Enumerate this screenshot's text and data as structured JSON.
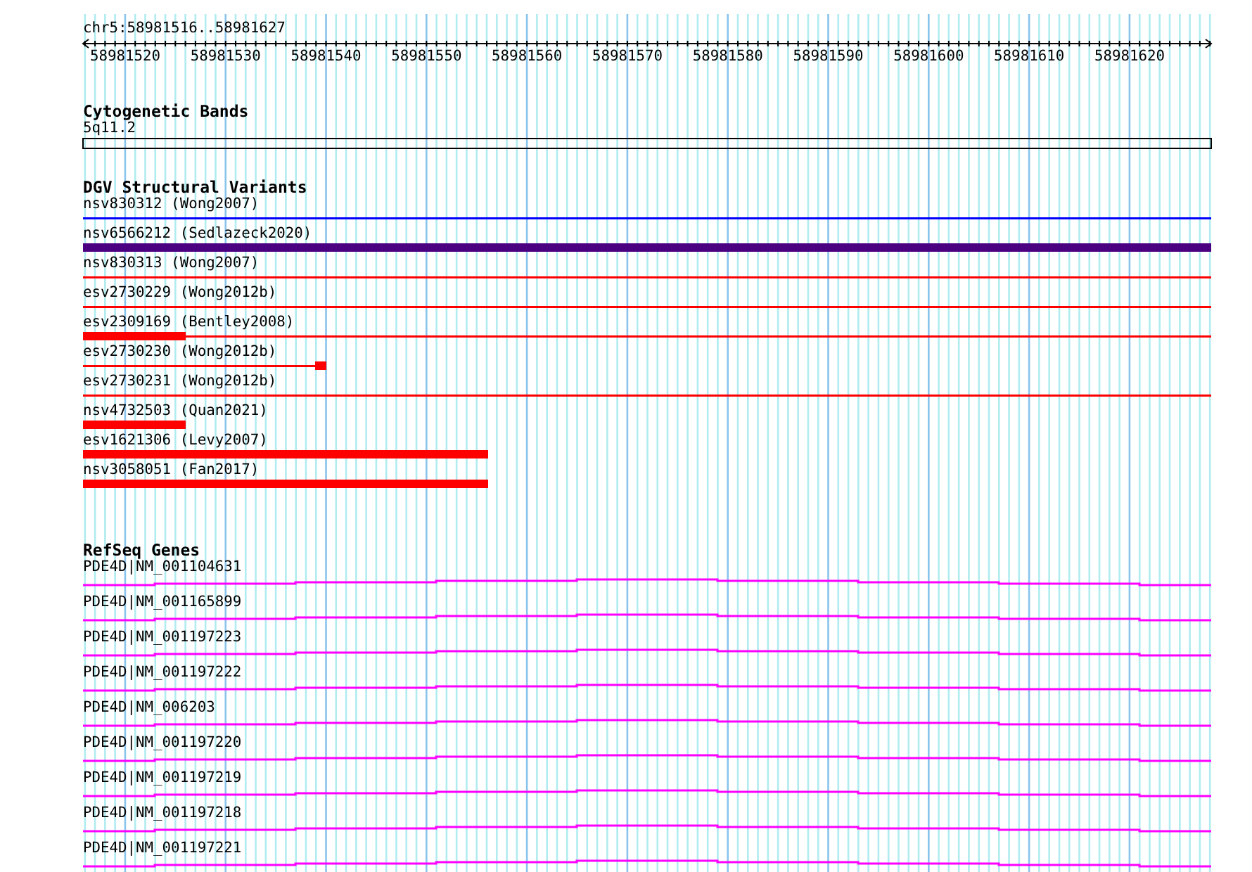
{
  "ruler": {
    "title": "chr5:58981516..58981627",
    "ticks": [
      "58981520",
      "58981530",
      "58981540",
      "58981550",
      "58981560",
      "58981570",
      "58981580",
      "58981590",
      "58981600",
      "58981610",
      "58981620"
    ]
  },
  "tracks": [
    {
      "title": "Cytogenetic Bands",
      "kind": "bands",
      "features": [
        {
          "label": "5q11.2"
        }
      ]
    },
    {
      "title": "DGV Structural Variants",
      "kind": "variants",
      "features": [
        {
          "label": "nsv830312 (Wong2007)",
          "color": "#0000ff"
        },
        {
          "label": "nsv6566212 (Sedlazeck2020)",
          "color": "#4b0082"
        },
        {
          "label": "nsv830313 (Wong2007)",
          "color": "#ff0000"
        },
        {
          "label": "esv2730229 (Wong2012b)",
          "color": "#ff0000"
        },
        {
          "label": "esv2309169 (Bentley2008)",
          "color": "#ff0000"
        },
        {
          "label": "esv2730230 (Wong2012b)",
          "color": "#ff0000"
        },
        {
          "label": "esv2730231 (Wong2012b)",
          "color": "#ff0000"
        },
        {
          "label": "nsv4732503 (Quan2021)",
          "color": "#ff0000"
        },
        {
          "label": "esv1621306 (Levy2007)",
          "color": "#ff0000"
        },
        {
          "label": "nsv3058051 (Fan2017)",
          "color": "#ff0000"
        }
      ]
    },
    {
      "title": "RefSeq Genes",
      "kind": "genes",
      "features": [
        {
          "label": "PDE4D|NM_001104631"
        },
        {
          "label": "PDE4D|NM_001165899"
        },
        {
          "label": "PDE4D|NM_001197223"
        },
        {
          "label": "PDE4D|NM_001197222"
        },
        {
          "label": "PDE4D|NM_006203"
        },
        {
          "label": "PDE4D|NM_001197220"
        },
        {
          "label": "PDE4D|NM_001197219"
        },
        {
          "label": "PDE4D|NM_001197218"
        },
        {
          "label": "PDE4D|NM_001197221"
        }
      ]
    }
  ]
}
